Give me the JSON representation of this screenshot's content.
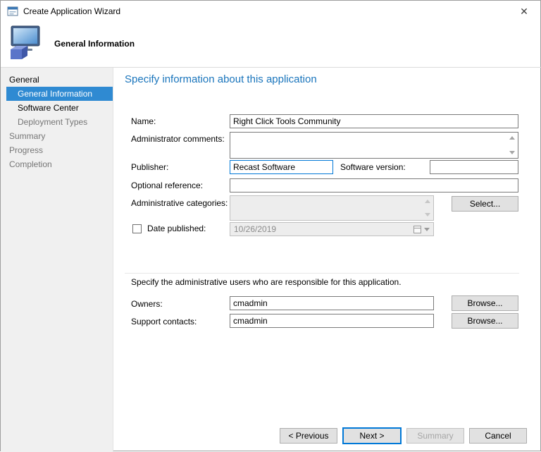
{
  "window": {
    "title": "Create Application Wizard",
    "close_symbol": "✕"
  },
  "header": {
    "title": "General Information"
  },
  "sidebar": {
    "items": [
      {
        "label": "General"
      },
      {
        "label": "General Information"
      },
      {
        "label": "Software Center"
      },
      {
        "label": "Deployment Types"
      },
      {
        "label": "Summary"
      },
      {
        "label": "Progress"
      },
      {
        "label": "Completion"
      }
    ]
  },
  "main": {
    "heading": "Specify information about this application",
    "name_label": "Name:",
    "name_value": "Right Click Tools Community",
    "comments_label": "Administrator comments:",
    "comments_value": "",
    "publisher_label": "Publisher:",
    "publisher_value": "Recast Software",
    "software_version_label": "Software version:",
    "software_version_value": "",
    "optional_reference_label": "Optional reference:",
    "optional_reference_value": "",
    "categories_label": "Administrative categories:",
    "categories_value": "",
    "select_button": "Select...",
    "date_published_label": "Date published:",
    "date_published_checked": false,
    "date_value": "10/26/2019",
    "admin_users_text": "Specify the administrative users who are responsible for this application.",
    "owners_label": "Owners:",
    "owners_value": "cmadmin",
    "support_label": "Support contacts:",
    "support_value": "cmadmin",
    "browse_button": "Browse..."
  },
  "footer": {
    "previous": "< Previous",
    "next": "Next >",
    "summary": "Summary",
    "cancel": "Cancel"
  },
  "colors": {
    "accent_blue": "#0078d7",
    "heading_blue": "#1a75bc",
    "nav_selected_blue": "#2f8ad2",
    "sidebar_gray": "#f0f0f0"
  }
}
